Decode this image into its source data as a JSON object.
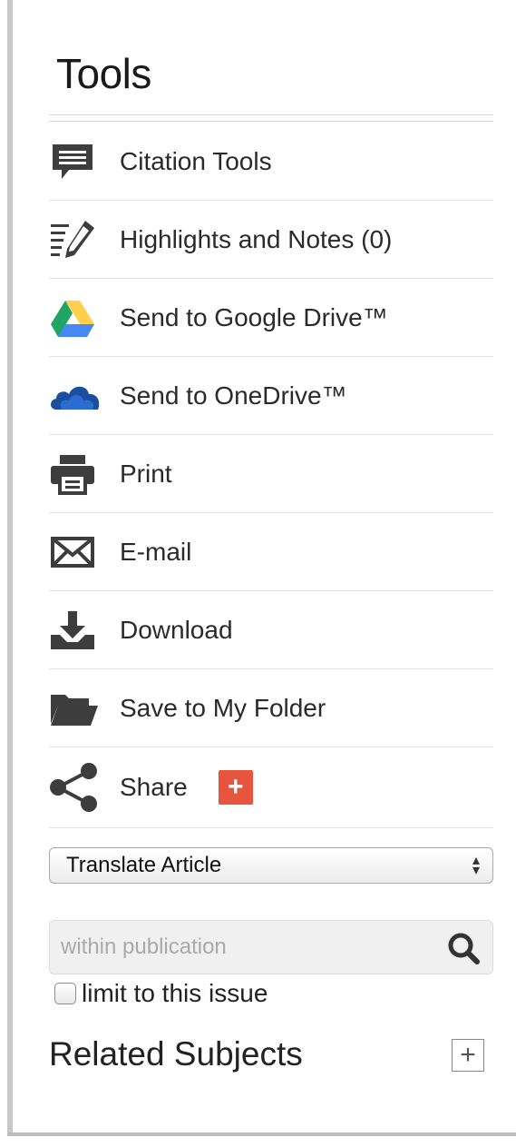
{
  "panel": {
    "title": "Tools"
  },
  "tools": [
    {
      "label": "Citation Tools",
      "icon": "speech-bubble-icon"
    },
    {
      "label": "Highlights and Notes (0)",
      "icon": "pencil-notes-icon"
    },
    {
      "label": "Send to Google Drive™",
      "icon": "google-drive-icon"
    },
    {
      "label": "Send to OneDrive™",
      "icon": "onedrive-cloud-icon"
    },
    {
      "label": "Print",
      "icon": "printer-icon"
    },
    {
      "label": "E-mail",
      "icon": "envelope-icon"
    },
    {
      "label": "Download",
      "icon": "download-icon"
    },
    {
      "label": "Save to My Folder",
      "icon": "folder-icon"
    },
    {
      "label": "Share",
      "icon": "share-icon",
      "badge": "+"
    }
  ],
  "translate": {
    "selected": "Translate Article"
  },
  "search": {
    "placeholder": "within publication",
    "limit_label": "limit to this issue",
    "limit_checked": false
  },
  "related": {
    "label": "Related Subjects",
    "expand_symbol": "+"
  },
  "colors": {
    "share_badge": "#e8553f",
    "onedrive": "#1a4fa0",
    "drive_green": "#1fa463",
    "drive_yellow": "#ffd04b",
    "drive_blue": "#4688f4",
    "icon_gray": "#3d3d3d"
  }
}
